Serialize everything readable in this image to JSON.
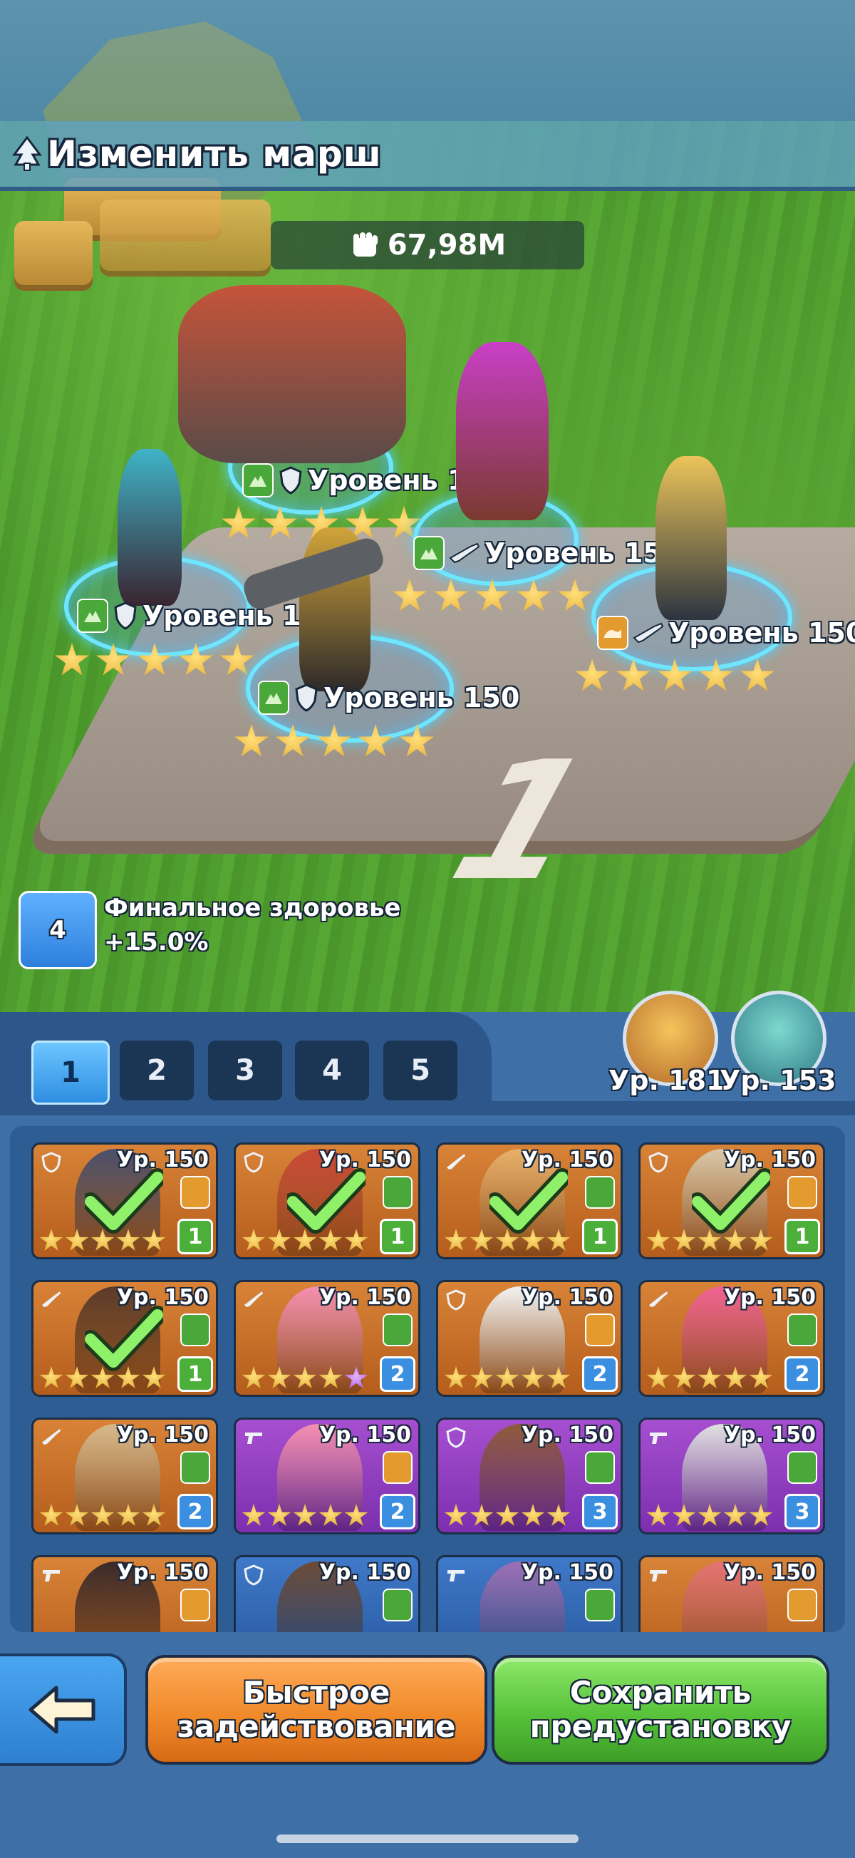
{
  "header": {
    "title": "Изменить марш"
  },
  "power": {
    "value": "67,98M"
  },
  "board": {
    "team_number": "1"
  },
  "formation": [
    {
      "level": "Уровень 150",
      "stars": 5
    },
    {
      "level": "Уровень 150",
      "stars": 5
    },
    {
      "level": "Уровень 150",
      "stars": 5
    },
    {
      "level": "Уровень 150",
      "stars": 5
    },
    {
      "level": "Уровень 150",
      "stars": 5
    }
  ],
  "buff": {
    "badge": "4",
    "title": "Финальное здоровье",
    "value": "+15.0%"
  },
  "tabs": [
    "1",
    "2",
    "3",
    "4",
    "5"
  ],
  "active_tab": "1",
  "pets": [
    {
      "level": "Ур. 181"
    },
    {
      "level": "Ур. 153"
    }
  ],
  "roster": [
    {
      "level": "Ур. 150",
      "team": "1",
      "selected": true,
      "rarity": "orange",
      "type": "shield-icon"
    },
    {
      "level": "Ур. 150",
      "team": "1",
      "selected": true,
      "rarity": "orange",
      "type": "shield-icon"
    },
    {
      "level": "Ур. 150",
      "team": "1",
      "selected": true,
      "rarity": "orange",
      "type": "rifle-icon"
    },
    {
      "level": "Ур. 150",
      "team": "1",
      "selected": true,
      "rarity": "orange",
      "type": "shield-icon"
    },
    {
      "level": "Ур. 150",
      "team": "1",
      "selected": true,
      "rarity": "orange",
      "type": "rifle-icon"
    },
    {
      "level": "Ур. 150",
      "team": "2",
      "selected": false,
      "rarity": "orange",
      "type": "rifle-icon"
    },
    {
      "level": "Ур. 150",
      "team": "2",
      "selected": false,
      "rarity": "orange",
      "type": "shield-icon"
    },
    {
      "level": "Ур. 150",
      "team": "2",
      "selected": false,
      "rarity": "orange",
      "type": "rifle-icon"
    },
    {
      "level": "Ур. 150",
      "team": "2",
      "selected": false,
      "rarity": "orange",
      "type": "rifle-icon"
    },
    {
      "level": "Ур. 150",
      "team": "2",
      "selected": false,
      "rarity": "purple",
      "type": "pistol-icon"
    },
    {
      "level": "Ур. 150",
      "team": "3",
      "selected": false,
      "rarity": "purple",
      "type": "shield-icon"
    },
    {
      "level": "Ур. 150",
      "team": "3",
      "selected": false,
      "rarity": "purple",
      "type": "pistol-icon"
    },
    {
      "level": "Ур. 150",
      "team": "",
      "selected": false,
      "rarity": "orange",
      "type": "pistol-icon"
    },
    {
      "level": "Ур. 150",
      "team": "",
      "selected": false,
      "rarity": "blue",
      "type": "shield-icon"
    },
    {
      "level": "Ур. 150",
      "team": "",
      "selected": false,
      "rarity": "blue",
      "type": "pistol-icon"
    },
    {
      "level": "Ур. 150",
      "team": "",
      "selected": false,
      "rarity": "orange",
      "type": "pistol-icon"
    }
  ],
  "buttons": {
    "quick_line1": "Быстрое",
    "quick_line2": "задействование",
    "save_line1": "Сохранить",
    "save_line2": "предустановку"
  },
  "colors": {
    "accent_blue": "#3e6fa6",
    "orange_button": "#f08a2a",
    "green_button": "#57c23a",
    "team_green": "#4caf3a",
    "team_blue": "#3a8fe0"
  }
}
